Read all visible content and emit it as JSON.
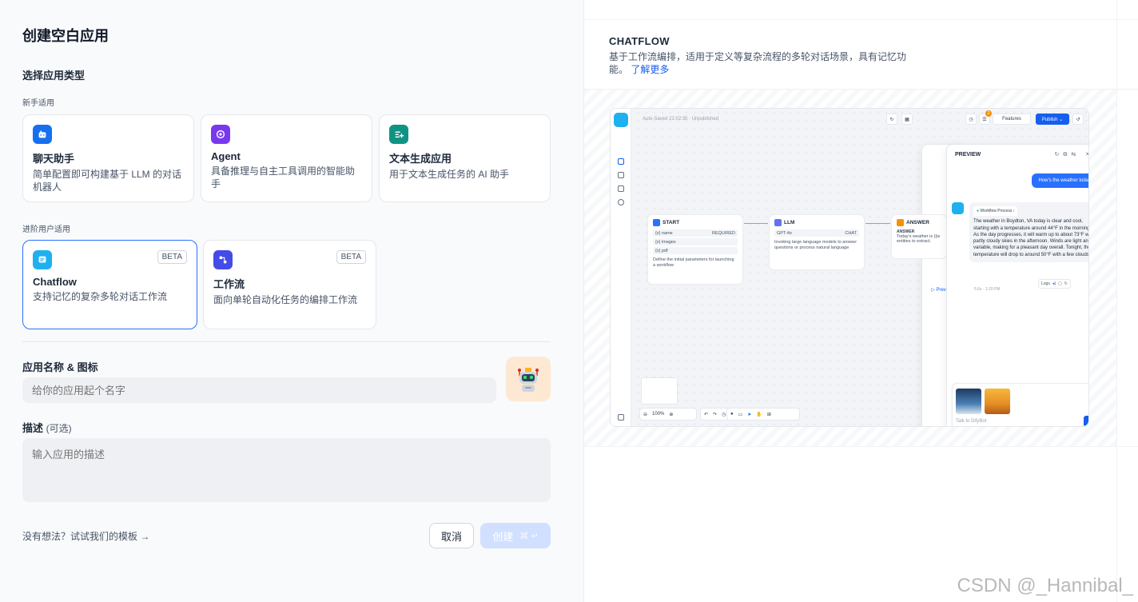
{
  "page_title": "创建空白应用",
  "app_type": {
    "section_title": "选择应用类型",
    "beginner_label": "新手适用",
    "advanced_label": "进阶用户适用",
    "beginner_cards": [
      {
        "title": "聊天助手",
        "desc": "简单配置即可构建基于 LLM 的对话机器人",
        "icon": "chat-bot-icon",
        "color": "#1570ef"
      },
      {
        "title": "Agent",
        "desc": "具备推理与自主工具调用的智能助手",
        "icon": "agent-icon",
        "color": "#7839ee"
      },
      {
        "title": "文本生成应用",
        "desc": "用于文本生成任务的 AI 助手",
        "icon": "text-generation-icon",
        "color": "#0e9384"
      }
    ],
    "advanced_cards": [
      {
        "title": "Chatflow",
        "desc": "支持记忆的复杂多轮对话工作流",
        "badge": "BETA",
        "icon": "chatflow-icon",
        "color": "#1fb0f0",
        "selected": true
      },
      {
        "title": "工作流",
        "desc": "面向单轮自动化任务的编排工作流",
        "badge": "BETA",
        "icon": "workflow-icon",
        "color": "#444ce7",
        "selected": false
      }
    ]
  },
  "name_field": {
    "label": "应用名称 & 图标",
    "placeholder": "给你的应用起个名字"
  },
  "desc_field": {
    "label": "描述",
    "optional": "(可选)",
    "placeholder": "输入应用的描述"
  },
  "template_link": "没有想法？试试我们的模板 →",
  "buttons": {
    "cancel": "取消",
    "create": "创建",
    "create_shortcut": "⌘ ↵"
  },
  "preview": {
    "title": "CHATFLOW",
    "desc": "基于工作流编排，适用于定义等复杂流程的多轮对话场景，具有记忆功能。",
    "learn_more": "了解更多",
    "mock": {
      "autosave": "Auto-Saved 21:02:35 · Unpublished",
      "toolbar_preview": "▷ Preview",
      "toolbar_features": "Features",
      "toolbar_publish": "Publish ⌄",
      "features_badge": "2",
      "nodes": {
        "start": {
          "title": "START",
          "fields": [
            [
              "{x} name",
              "REQUIRED"
            ],
            [
              "{x} images",
              ""
            ],
            [
              "{x} pdf",
              ""
            ]
          ],
          "desc": "Define the initial parameters for launching a workflow"
        },
        "llm": {
          "title": "LLM",
          "model": "GPT-4o",
          "mode": "CHAT",
          "desc": "Invoking large language models to answer questions or process natural language"
        },
        "answer": {
          "title": "ANSWER",
          "label": "ANSWER",
          "desc": "Today's weather is {{w",
          "desc2": "entities to extract."
        }
      },
      "preview_panel": {
        "title": "PREVIEW",
        "user_msg": "How's the weather today",
        "workflow_process": "Workflow Process ›",
        "bot_msg": "The weather in Boydton, VA today is clear and cool, starting with a temperature around 44°F in the morning. As the day progresses, it will warm up to about 73°F with partly cloudy skies in the afternoon. Winds are light and variable, making for a pleasant day overall. Tonight, the temperature will drop to around 50°F with a few clouds.",
        "meta": "5.6s · 1:20 PM",
        "logs": "Logs",
        "input_placeholder": "Talk to DifyBot"
      },
      "zoom": "100%"
    }
  },
  "watermark": "CSDN @_Hannibal_"
}
